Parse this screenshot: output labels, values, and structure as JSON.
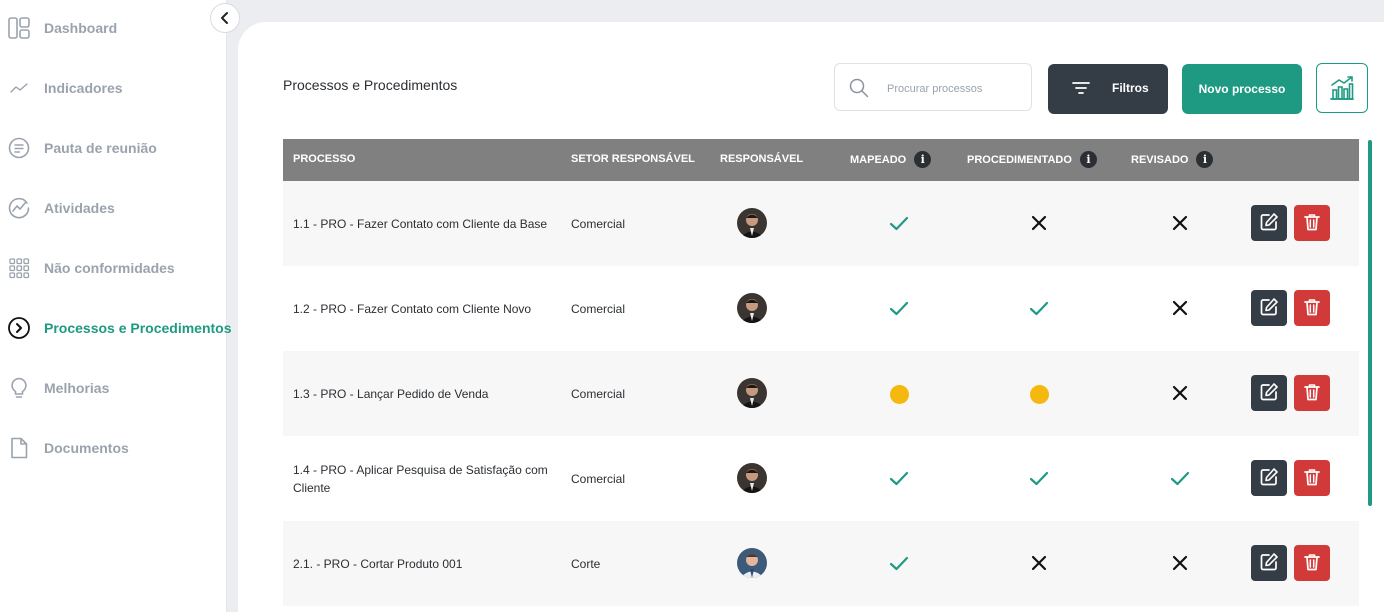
{
  "sidebar": {
    "items": [
      {
        "label": "Dashboard",
        "icon": "dashboard-icon",
        "active": false
      },
      {
        "label": "Indicadores",
        "icon": "trend-icon",
        "active": false
      },
      {
        "label": "Pauta de reunião",
        "icon": "agenda-icon",
        "active": false
      },
      {
        "label": "Atividades",
        "icon": "activity-icon",
        "active": false
      },
      {
        "label": "Não conformidades",
        "icon": "grid-icon",
        "active": false
      },
      {
        "label": "Processos e Procedimentos",
        "icon": "chevron-circle-icon",
        "active": true
      },
      {
        "label": "Melhorias",
        "icon": "lightbulb-icon",
        "active": false
      },
      {
        "label": "Documentos",
        "icon": "document-icon",
        "active": false
      }
    ]
  },
  "header": {
    "title": "Processos e Procedimentos",
    "search_placeholder": "Procurar processos",
    "filter_label": "Filtros",
    "new_label": "Novo processo"
  },
  "table": {
    "columns": {
      "processo": "PROCESSO",
      "setor": "SETOR RESPONSÁVEL",
      "responsavel": "RESPONSÁVEL",
      "mapeado": "MAPEADO",
      "procedimentado": "PROCEDIMENTADO",
      "revisado": "REVISADO",
      "info": "i"
    },
    "rows": [
      {
        "processo": "1.1 - PRO - Fazer Contato com Cliente da Base",
        "setor": "Comercial",
        "avatar": "dark",
        "mapeado": "done",
        "procedimentado": "no",
        "revisado": "no"
      },
      {
        "processo": "1.2 - PRO - Fazer Contato com Cliente Novo",
        "setor": "Comercial",
        "avatar": "dark",
        "mapeado": "done",
        "procedimentado": "done",
        "revisado": "no"
      },
      {
        "processo": "1.3 - PRO - Lançar Pedido de Venda",
        "setor": "Comercial",
        "avatar": "dark",
        "mapeado": "pending",
        "procedimentado": "pending",
        "revisado": "no"
      },
      {
        "processo": "1.4 - PRO - Aplicar Pesquisa de Satisfação com Cliente",
        "setor": "Comercial",
        "avatar": "dark",
        "mapeado": "done",
        "procedimentado": "done",
        "revisado": "done"
      },
      {
        "processo": "2.1. - PRO - Cortar Produto 001",
        "setor": "Corte",
        "avatar": "blue",
        "mapeado": "done",
        "procedimentado": "no",
        "revisado": "no"
      }
    ]
  },
  "colors": {
    "accent": "#1f9a82",
    "dark": "#343d46",
    "danger": "#d23a3a",
    "pending": "#f5b80f",
    "header_gray": "#808080"
  }
}
